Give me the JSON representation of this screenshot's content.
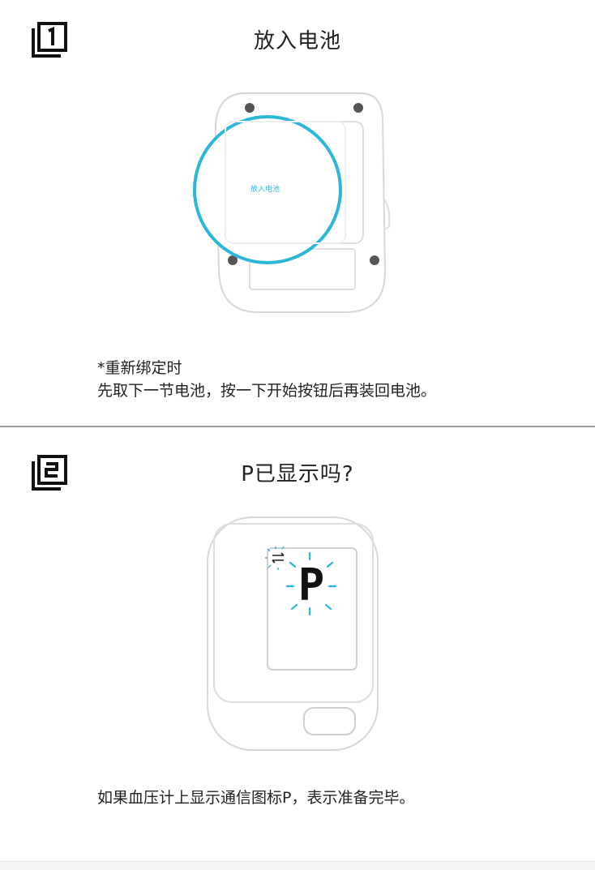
{
  "step1": {
    "title": "放入电池",
    "bubble_label": "放入电池",
    "note_line1": "*重新绑定时",
    "note_line2": "先取下一节电池，按一下开始按钮后再装回电池。"
  },
  "step2": {
    "title": "P已显示吗?",
    "display_symbol": "P",
    "note": "如果血压计上显示通信图标P，表示准备完毕。"
  },
  "colors": {
    "accent": "#2ab7d8",
    "outline": "#d8d8d8",
    "text": "#222222"
  },
  "icons": {
    "step1": "step-1-icon",
    "step2": "step-2-icon",
    "link": "communication-icon"
  }
}
